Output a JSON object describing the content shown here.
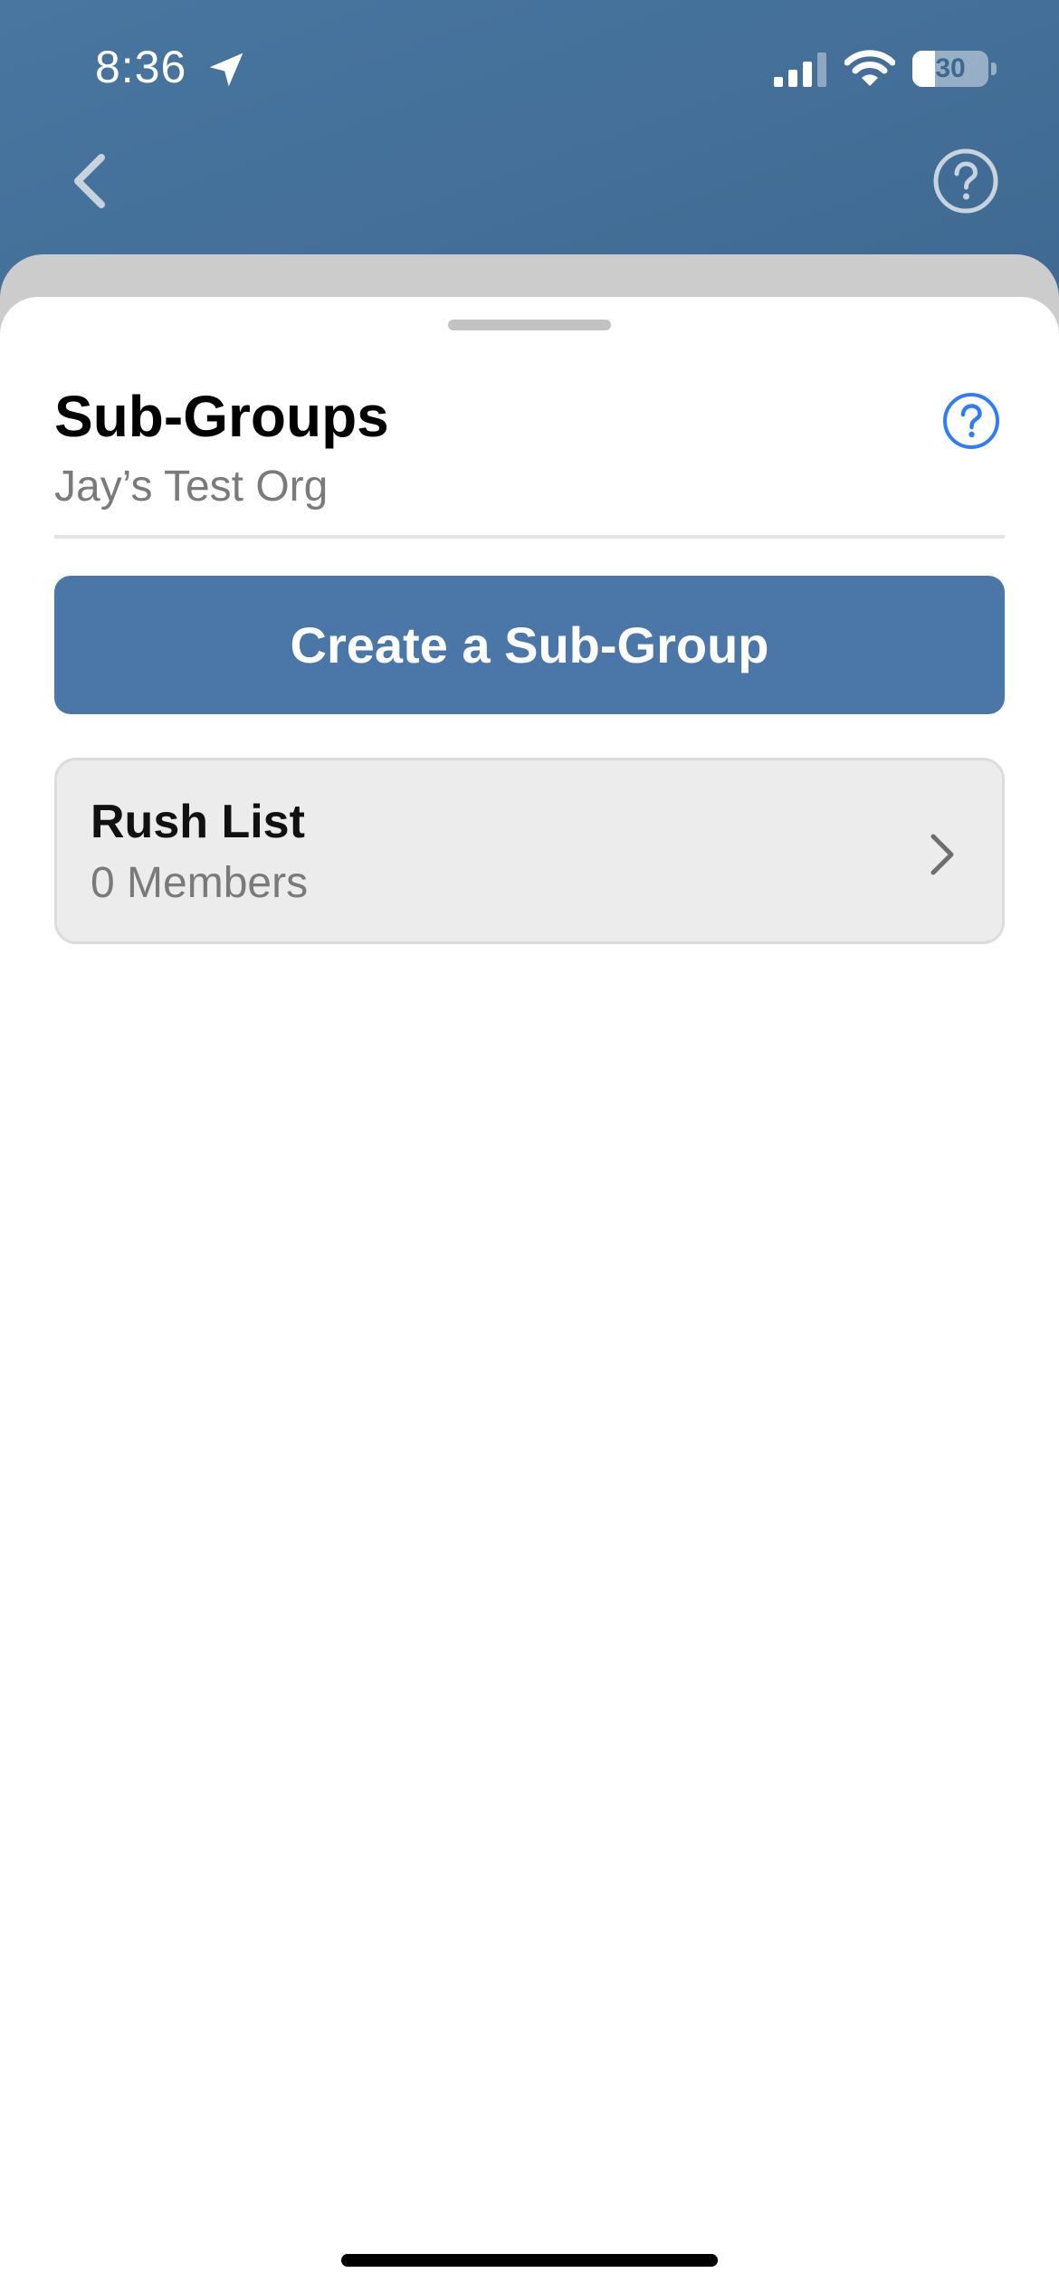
{
  "status_bar": {
    "time": "8:36",
    "battery_text": "30",
    "battery_level": 0.3,
    "icons": [
      "location-arrow-icon",
      "cellular-signal-icon",
      "wifi-icon",
      "battery-icon"
    ]
  },
  "nav": {
    "back_icon": "chevron-left-icon",
    "help_icon": "question-circle-icon"
  },
  "page": {
    "title": "Sub-Groups",
    "subtitle": "Jay’s Test Org",
    "help_icon": "question-circle-icon"
  },
  "actions": {
    "create_label": "Create a Sub-Group"
  },
  "groups": [
    {
      "name": "Rush List",
      "members": "0 Members"
    }
  ],
  "colors": {
    "header_bg": "#4876a0",
    "primary_button": "#4a76a8",
    "help_accent": "#2f7cf6",
    "list_item_bg": "#ececec",
    "secondary_text": "#7a7a7a"
  }
}
